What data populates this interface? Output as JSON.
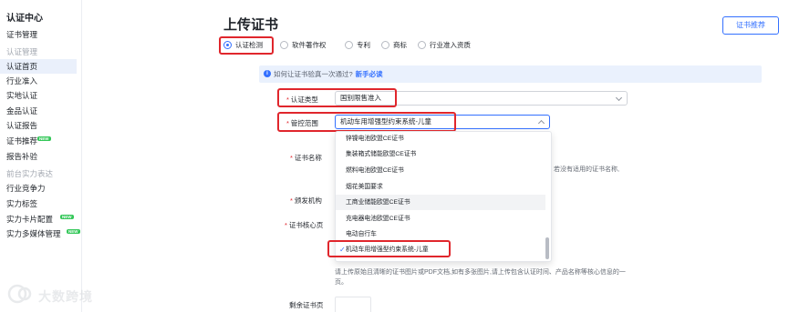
{
  "sidebar": {
    "title": "认证中心",
    "items": [
      {
        "label": "证书管理",
        "type": "item"
      },
      {
        "label": "认证管理",
        "type": "group"
      },
      {
        "label": "认证首页",
        "type": "item",
        "active": true
      },
      {
        "label": "行业准入",
        "type": "item"
      },
      {
        "label": "实地认证",
        "type": "item"
      },
      {
        "label": "金品认证",
        "type": "item"
      },
      {
        "label": "认证报告",
        "type": "item"
      },
      {
        "label": "证书推荐",
        "type": "item",
        "badge": "NEW"
      },
      {
        "label": "报告补验",
        "type": "item"
      },
      {
        "label": "前台实力表达",
        "type": "group"
      },
      {
        "label": "行业竞争力",
        "type": "item"
      },
      {
        "label": "实力标签",
        "type": "item"
      },
      {
        "label": "实力卡片配置",
        "type": "item",
        "badge": "NEW"
      },
      {
        "label": "实力多媒体管理",
        "type": "item",
        "badge": "NEW"
      }
    ]
  },
  "header": {
    "title": "上传证书",
    "recommend_button": "证书推荐"
  },
  "tabs": [
    {
      "label": "认证检测",
      "checked": true
    },
    {
      "label": "软件著作权",
      "checked": false
    },
    {
      "label": "专利",
      "checked": false
    },
    {
      "label": "商标",
      "checked": false
    },
    {
      "label": "行业准入资质",
      "checked": false
    }
  ],
  "info_bar": {
    "icon": "info-icon",
    "text": "如何让证书验真一次通过?",
    "link": "新手必读"
  },
  "form": {
    "cert_type_label": "认证类型",
    "cert_type_value": "国别限售准入",
    "scope_label": "管控范围",
    "scope_value": "机动车用增强型约束系统-儿童",
    "cert_name_label": "证书名称",
    "issuer_label": "颁发机构",
    "core_page_label": "证书核心页",
    "remaining_pages_label": "剩余证书页",
    "name_hint_suffix": "。若没有适用的证书名称,",
    "upload_hint_line1": "请上传原始且清晰的证书图片或PDF文档,如有多张图片,请上传包含认证时间、产品名称等核心信息的一",
    "upload_hint_line2": "页。"
  },
  "dropdown": {
    "options": [
      {
        "label": "锌镍电池欧盟CE证书"
      },
      {
        "label": "集装箱式储能欧盟CE证书"
      },
      {
        "label": "燃料电池欧盟CE证书"
      },
      {
        "label": "烟花美国要求"
      },
      {
        "label": "工商业储能欧盟CE证书",
        "hover": true
      },
      {
        "label": "充电器电池欧盟CE证书"
      },
      {
        "label": "电动自行车"
      },
      {
        "label": "机动车用增强型约束系统-儿童",
        "selected": true
      }
    ]
  },
  "watermark": {
    "text": "大数跨境"
  },
  "colors": {
    "accent": "#3370ff",
    "highlight_border": "#e0262c",
    "new_badge": "#34c759"
  }
}
